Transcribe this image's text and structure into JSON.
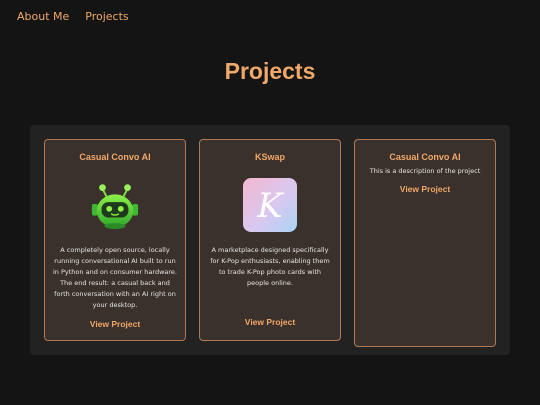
{
  "nav": {
    "items": [
      {
        "label": "About Me"
      },
      {
        "label": "Projects"
      }
    ]
  },
  "page": {
    "title": "Projects"
  },
  "projects": [
    {
      "title": "Casual Convo AI",
      "icon": "robot-head-icon",
      "description": "A completely open source, locally running conversational AI built to run in Python and on consumer hardware. The end result: a casual back and forth conversation with an AI right on your desktop.",
      "link_label": "View Project"
    },
    {
      "title": "KSwap",
      "icon": "kswap-logo-icon",
      "logo_letter": "K",
      "description": "A marketplace designed specifically for K-Pop enthusiasts, enabling them to trade K-Pop photo cards with people online.",
      "link_label": "View Project"
    },
    {
      "title": "Casual Convo AI",
      "description": "This is a description of the project",
      "link_label": "View Project"
    }
  ],
  "colors": {
    "background": "#141414",
    "accent": "#f0a868",
    "panel": "#222222",
    "card": "#3a302c",
    "card_border": "#b07a54"
  }
}
